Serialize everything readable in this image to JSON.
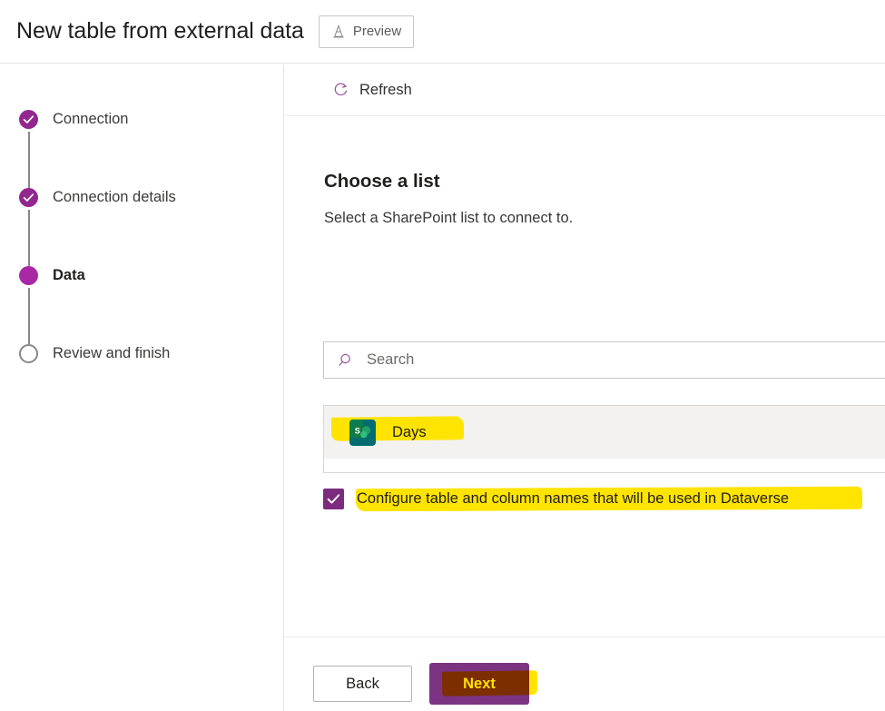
{
  "header": {
    "title": "New table from external data",
    "preview_label": "Preview",
    "preview_icon": "cone-icon"
  },
  "sidebar": {
    "steps": [
      {
        "label": "Connection",
        "state": "done",
        "icon": "check-circle-icon"
      },
      {
        "label": "Connection details",
        "state": "done",
        "icon": "check-circle-icon"
      },
      {
        "label": "Data",
        "state": "current",
        "icon": "filled-circle-icon"
      },
      {
        "label": "Review and finish",
        "state": "todo",
        "icon": "empty-circle-icon"
      }
    ]
  },
  "command_bar": {
    "refresh_label": "Refresh",
    "refresh_icon": "refresh-icon"
  },
  "main": {
    "section_title": "Choose a list",
    "section_subtitle": "Select a SharePoint list to connect to.",
    "search": {
      "placeholder": "Search",
      "value": "",
      "icon": "search-icon"
    },
    "list_items": [
      {
        "label": "Days",
        "icon": "sharepoint-icon",
        "selected": true,
        "highlighted": true
      }
    ],
    "checkbox": {
      "label": "Configure table and column names that will be used in Dataverse",
      "checked": true,
      "highlighted": true
    }
  },
  "footer": {
    "back_label": "Back",
    "next_label": "Next"
  },
  "colors": {
    "accent_purple": "#7c3382",
    "step_done": "#92278f",
    "step_current": "#a829a3",
    "highlighter_yellow": "#ffe400",
    "row_hover_gray": "#f3f2f1",
    "border_gray": "#d8d6d4",
    "sharepoint_teal": "#036c70",
    "sharepoint_green": "#1a9b5e"
  }
}
